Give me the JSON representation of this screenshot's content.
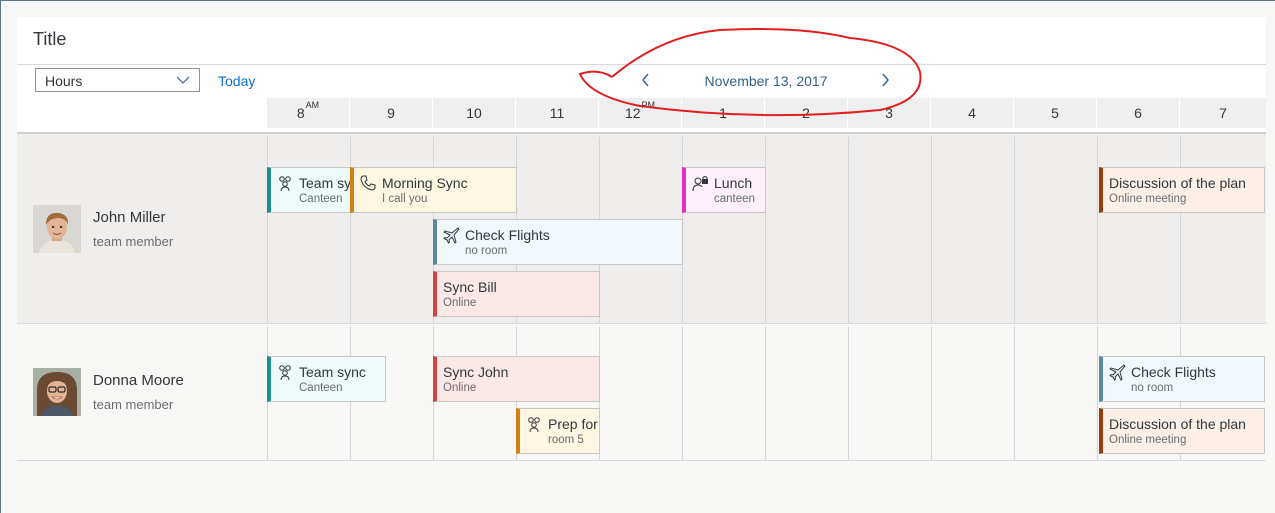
{
  "header": {
    "title": "Title"
  },
  "toolbar": {
    "view_select": {
      "value": "Hours"
    },
    "today_label": "Today",
    "date_label": "November 13, 2017"
  },
  "hours": [
    {
      "label": "8",
      "suffix": "AM"
    },
    {
      "label": "9",
      "suffix": ""
    },
    {
      "label": "10",
      "suffix": ""
    },
    {
      "label": "11",
      "suffix": ""
    },
    {
      "label": "12",
      "suffix": "PM"
    },
    {
      "label": "1",
      "suffix": ""
    },
    {
      "label": "2",
      "suffix": ""
    },
    {
      "label": "3",
      "suffix": ""
    },
    {
      "label": "4",
      "suffix": ""
    },
    {
      "label": "5",
      "suffix": ""
    },
    {
      "label": "6",
      "suffix": ""
    },
    {
      "label": "7",
      "suffix": ""
    }
  ],
  "rows": [
    {
      "name": "John Miller",
      "role": "team member",
      "appointments": [
        {
          "title": "Team sync",
          "subtitle": "Canteen",
          "icon": "group-icon",
          "accent": "#1b8f8f",
          "bg": "#eef9f9"
        },
        {
          "title": "Morning Sync",
          "subtitle": "I call you",
          "icon": "phone-icon",
          "accent": "#d08014",
          "bg": "#fef6e0"
        },
        {
          "title": "Lunch",
          "subtitle": "canteen",
          "icon": "private-person-icon",
          "accent": "#e52dc0",
          "bg": "#fdf0fa"
        },
        {
          "title": "Discussion of the plan",
          "subtitle": "Online meeting",
          "icon": "",
          "accent": "#9a3b0a",
          "bg": "#fcefe6"
        },
        {
          "title": "Check Flights",
          "subtitle": "no room",
          "icon": "flight-icon",
          "accent": "#5b8a9e",
          "bg": "#f0f8fb"
        },
        {
          "title": "Sync Bill",
          "subtitle": "Online",
          "icon": "",
          "accent": "#d04343",
          "bg": "#fbe8e7"
        }
      ]
    },
    {
      "name": "Donna Moore",
      "role": "team member",
      "appointments": [
        {
          "title": "Team sync",
          "subtitle": "Canteen",
          "icon": "group-icon",
          "accent": "#1b8f8f",
          "bg": "#eef9f9"
        },
        {
          "title": "Sync John",
          "subtitle": "Online",
          "icon": "",
          "accent": "#d04343",
          "bg": "#fbe8e7"
        },
        {
          "title": "Check Flights",
          "subtitle": "no room",
          "icon": "flight-icon",
          "accent": "#5b8a9e",
          "bg": "#f0f8fb"
        },
        {
          "title": "Prep for",
          "subtitle": "room 5",
          "icon": "group-icon",
          "accent": "#d08014",
          "bg": "#fef6e0"
        },
        {
          "title": "Discussion of the plan",
          "subtitle": "Online meeting",
          "icon": "",
          "accent": "#9a3b0a",
          "bg": "#fcefe6"
        }
      ]
    }
  ]
}
